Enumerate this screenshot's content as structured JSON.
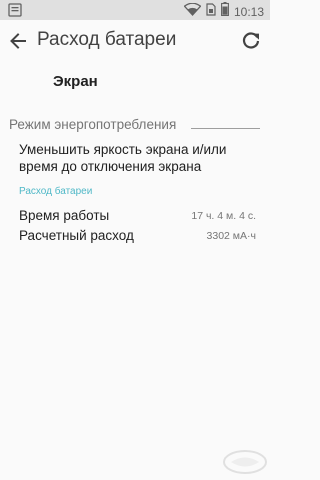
{
  "status_bar": {
    "time": "10:13",
    "icons": [
      "notification-icon",
      "wifi-icon",
      "sim-icon",
      "battery-icon"
    ]
  },
  "toolbar": {
    "title": "Расход батареи",
    "back_icon": "back-arrow-icon",
    "refresh_icon": "refresh-icon"
  },
  "app": {
    "name": "Экран"
  },
  "section": {
    "title": "Режим энергопотребления",
    "action_label": "Уменьшить яркость экрана и/или время до отключения экрана"
  },
  "usage": {
    "header": "Расход батареи",
    "rows": [
      {
        "label": "Время работы",
        "value": "17 ч. 4 м. 4 с."
      },
      {
        "label": "Расчетный расход",
        "value": "3302 мА·ч"
      }
    ]
  },
  "colors": {
    "accent": "#4fb8c7",
    "status_bar": "#e0e0e0",
    "background": "#fafafa"
  }
}
